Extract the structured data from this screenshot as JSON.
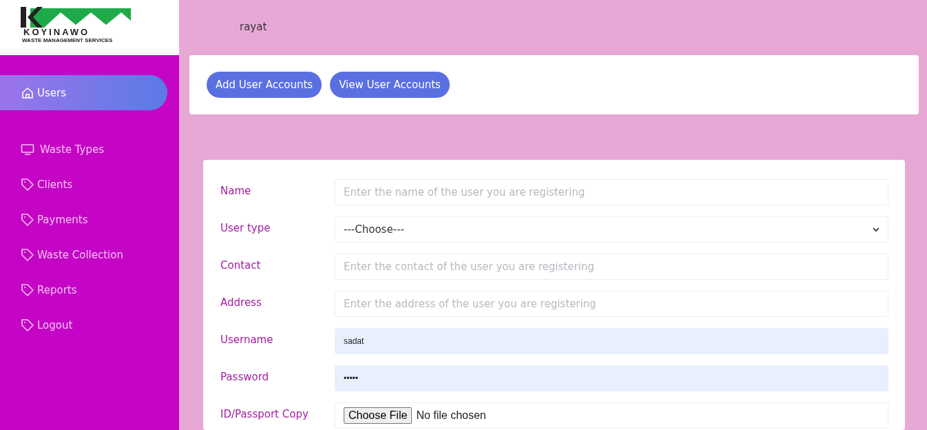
{
  "logo": {
    "name": "KOYINAWO",
    "tagline": "WASTE MANAGEMENT SERVICES"
  },
  "header": {
    "user": "rayat"
  },
  "sidebar": {
    "items": [
      {
        "label": "Users",
        "kind": "home",
        "selected": true
      },
      {
        "label": "Waste Types",
        "kind": "monitor",
        "selected": false
      },
      {
        "label": "Clients",
        "kind": "tag",
        "selected": false
      },
      {
        "label": "Payments",
        "kind": "tag",
        "selected": false
      },
      {
        "label": "Waste Collection",
        "kind": "tag",
        "selected": false
      },
      {
        "label": "Reports",
        "kind": "tag",
        "selected": false
      },
      {
        "label": "Logout",
        "kind": "tag",
        "selected": false
      }
    ]
  },
  "actions": [
    "Add User Accounts",
    "View User Accounts"
  ],
  "form": {
    "fields": [
      {
        "label": "Name",
        "kind": "text",
        "placeholder": "Enter the name of the user you are registering"
      },
      {
        "label": "User type",
        "kind": "select",
        "value": "---Choose---"
      },
      {
        "label": "Contact",
        "kind": "text",
        "placeholder": "Enter the contact of the user you are registering"
      },
      {
        "label": "Address",
        "kind": "text",
        "placeholder": "Enter the address of the user you are registering"
      },
      {
        "label": "Username",
        "kind": "text",
        "value": "sadat"
      },
      {
        "label": "Password",
        "kind": "text",
        "value": "•••••"
      },
      {
        "label": "ID/Passport Copy",
        "kind": "file",
        "button": "Choose File",
        "status": "No file chosen"
      }
    ]
  }
}
